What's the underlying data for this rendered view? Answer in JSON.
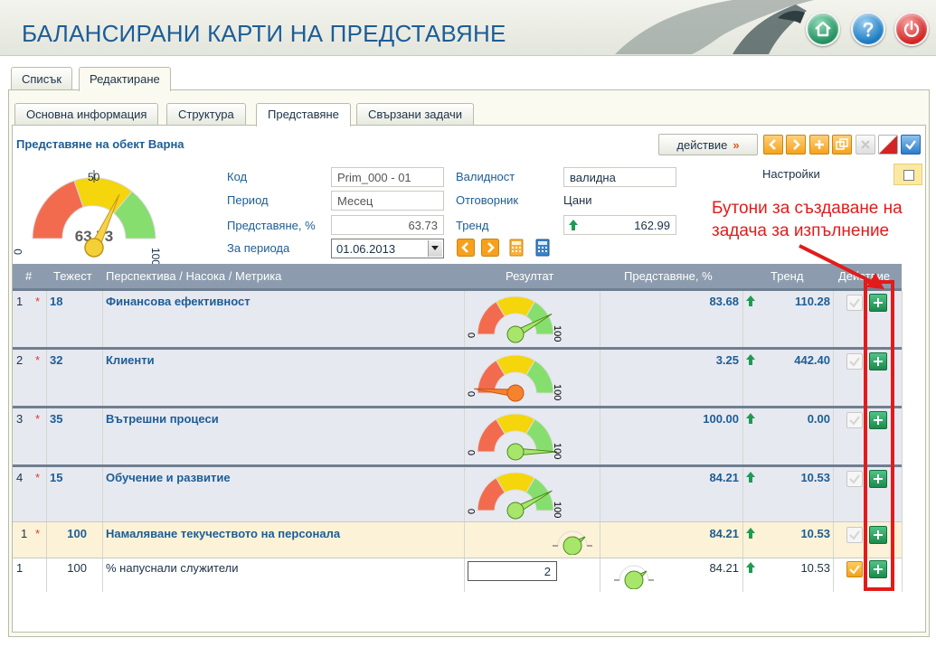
{
  "header": {
    "title": "БАЛАНСИРАНИ КАРТИ НА ПРЕДСТАВЯНЕ",
    "buttons": [
      "home-icon",
      "help-icon",
      "power-icon"
    ]
  },
  "outer_tabs": [
    {
      "label": "Списък",
      "active": false
    },
    {
      "label": "Редактиране",
      "active": true
    }
  ],
  "inner_tabs": [
    {
      "label": "Основна информация",
      "active": false
    },
    {
      "label": "Структура",
      "active": false
    },
    {
      "label": "Представяне",
      "active": true
    },
    {
      "label": "Свързани задачи",
      "active": false
    }
  ],
  "object_title": "Представяне на обект Варна",
  "toolbar": {
    "action_label": "действие",
    "action_chevron": "»",
    "icons": [
      "prev-icon",
      "next-icon",
      "add-icon",
      "copy-icon",
      "delete-icon",
      "cancel-icon",
      "confirm-icon"
    ]
  },
  "settings": {
    "label": "Настройки",
    "checked": false
  },
  "gauge": {
    "value_label": "63.73",
    "value": 63.73,
    "min_label": "0",
    "mid_label": "50",
    "max_label": "100",
    "colors": {
      "red": "#f36b4f",
      "yellow": "#f5d50c",
      "green": "#86de6e"
    }
  },
  "form": {
    "code_label": "Код",
    "code_value": "Prim_000 - 01",
    "period_label": "Период",
    "period_value": "Месец",
    "perf_label": "Представяне, %",
    "perf_value": "63.73",
    "for_period_label": "За периода",
    "for_period_value": "01.06.2013",
    "validity_label": "Валидност",
    "validity_value": "валидна",
    "owner_label": "Отговорник",
    "owner_value": "Цани",
    "trend_label": "Тренд",
    "trend_value": "162.99"
  },
  "table": {
    "headers": {
      "num": "#",
      "weight": "Тежест",
      "name": "Перспектива / Насока / Метрика",
      "result": "Резултат",
      "perf": "Представяне, %",
      "trend": "Тренд",
      "action": "Действие"
    },
    "rows": [
      {
        "kind": "perspective",
        "num": "1",
        "mark": "*",
        "weight": "18",
        "name": "Финансова ефективност",
        "perf": "83.68",
        "trend": "110.28",
        "gauge": 83.68
      },
      {
        "kind": "perspective",
        "num": "2",
        "mark": "*",
        "weight": "32",
        "name": "Клиенти",
        "perf": "3.25",
        "trend": "442.40",
        "gauge": 3.25
      },
      {
        "kind": "perspective",
        "num": "3",
        "mark": "*",
        "weight": "35",
        "name": "Вътрешни процеси",
        "perf": "100.00",
        "trend": "0.00",
        "gauge": 100
      },
      {
        "kind": "perspective",
        "num": "4",
        "mark": "*",
        "weight": "15",
        "name": "Обучение и развитие",
        "perf": "84.21",
        "trend": "10.53",
        "gauge": 84.21
      },
      {
        "kind": "goal",
        "num": "1",
        "mark": "*",
        "weight": "100",
        "name": "Намаляване текучеството на персонала",
        "perf": "84.21",
        "trend": "10.53"
      },
      {
        "kind": "metric",
        "num": "1",
        "mark": "",
        "weight": "100",
        "name": "% напуснали служители",
        "input_value": "2",
        "perf": "84.21",
        "trend": "10.53"
      }
    ],
    "gauge_min_label": "0",
    "gauge_max_label": "100"
  },
  "annotation": "Бутони за създаване на задача за изпълнение"
}
